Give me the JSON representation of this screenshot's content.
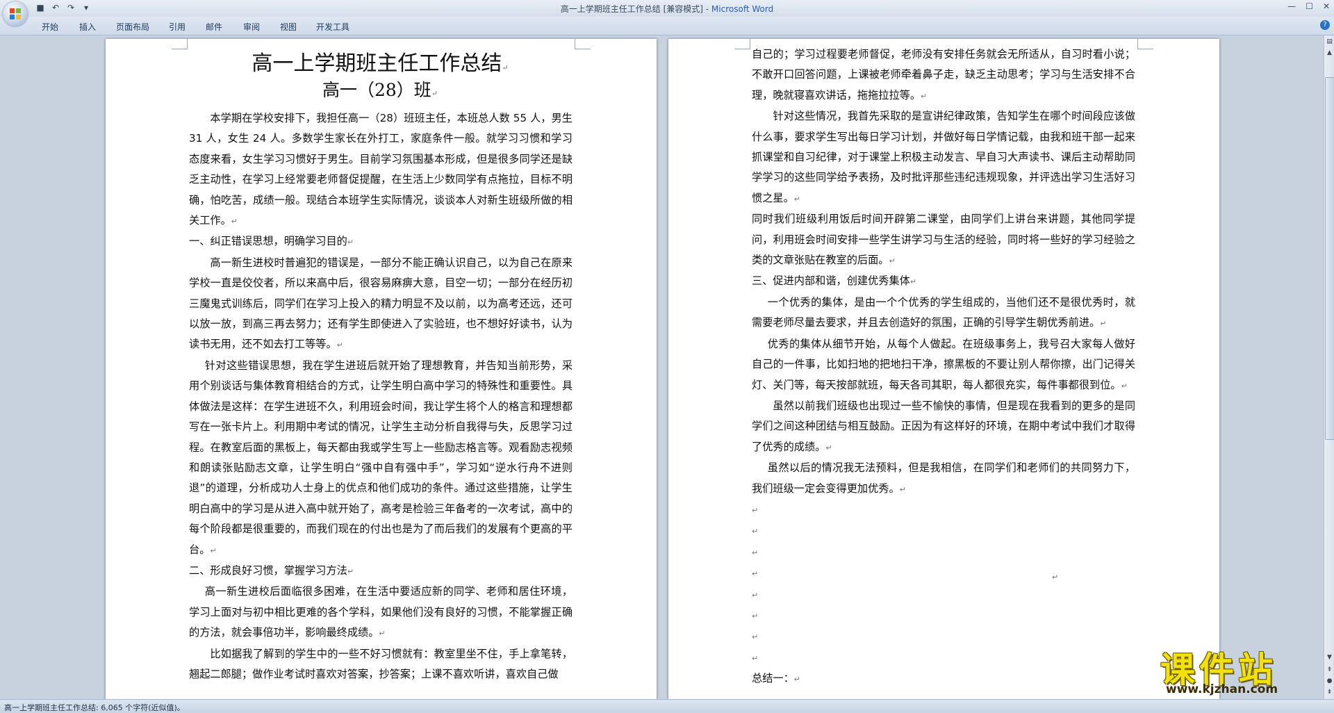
{
  "window": {
    "title": "高一上学期班主任工作总结 [兼容模式] - ",
    "app_name": "Microsoft Word"
  },
  "ribbon": {
    "tabs": [
      "开始",
      "插入",
      "页面布局",
      "引用",
      "邮件",
      "审阅",
      "视图",
      "开发工具"
    ]
  },
  "doc": {
    "title": "高一上学期班主任工作总结",
    "subtitle": "高一（28）班",
    "left_page": [
      {
        "text": "本学期在学校安排下，我担任高一（28）班班主任，本班总人数 55 人，男生 31 人，女生 24 人。多数学生家长在外打工，家庭条件一般。就学习习惯和学习态度来看，女生学习习惯好于男生。目前学习氛围基本形成，但是很多同学还是缺乏主动性，在学习上经常要老师督促提醒，在生活上少数同学有点拖拉，目标不明确，怕吃苦，成绩一般。现结合本班学生实际情况，谈谈本人对新生班级所做的相关工作。",
        "style": "indent"
      },
      {
        "text": "一、纠正错误思想，明确学习目的",
        "style": "plain"
      },
      {
        "text": "高一新生进校时普遍犯的错误是，一部分不能正确认识自己，以为自己在原来学校一直是佼佼者，所以来高中后，很容易麻痹大意，目空一切；一部分在经历初三魔鬼式训练后，同学们在学习上投入的精力明显不及以前，以为高考还远，还可以放一放，到高三再去努力；还有学生即使进入了实验班，也不想好好读书，认为读书无用，还不如去打工等等。",
        "style": "indent"
      },
      {
        "text": "针对这些错误思想，我在学生进班后就开始了理想教育，并告知当前形势，采用个别谈话与集体教育相结合的方式，让学生明白高中学习的特殊性和重要性。具体做法是这样：在学生进班不久，利用班会时间，我让学生将个人的格言和理想都写在一张卡片上。利用期中考试的情况，让学生主动分析自我得与失，反思学习过程。在教室后面的黑板上，每天都由我或学生写上一些励志格言等。观看励志视频和朗读张贴励志文章，让学生明白“强中自有强中手”，学习如“逆水行舟不进则退”的道理，分析成功人士身上的优点和他们成功的条件。通过这些措施，让学生明白高中的学习是从进入高中就开始了，高考是检验三年备考的一次考试，高中的每个阶段都是很重要的，而我们现在的付出也是为了而后我们的发展有个更高的平台。",
        "style": "indent1"
      },
      {
        "text": "二、形成良好习惯，掌握学习方法",
        "style": "plain"
      },
      {
        "text": "高一新生进校后面临很多困难，在生活中要适应新的同学、老师和居住环境，学习上面对与初中相比更难的各个学科，如果他们没有良好的习惯，不能掌握正确的方法，就会事倍功半，影响最终成绩。",
        "style": "indent1"
      },
      {
        "text": "比如据我了解到的学生中的一些不好习惯就有：教室里坐不住，手上拿笔转，翘起二郎腿；做作业考试时喜欢对答案，抄答案；上课不喜欢听讲，喜欢自己做",
        "style": "indent",
        "no_mark": true
      }
    ],
    "right_page": [
      {
        "text": "自己的；学习过程要老师督促，老师没有安排任务就会无所适从，自习时看小说；不敢开口回答问题，上课被老师牵着鼻子走，缺乏主动思考；学习与生活安排不合理，晚就寝喜欢讲话，拖拖拉拉等。",
        "style": "plain"
      },
      {
        "text": "针对这些情况，我首先采取的是宣讲纪律政策，告知学生在哪个时间段应该做什么事，要求学生写出每日学习计划，并做好每日学情记载，由我和班干部一起来抓课堂和自习纪律，对于课堂上积极主动发言、早自习大声读书、课后主动帮助同学学习的这些同学给予表扬，及时批评那些违纪违规现象，并评选出学习生活好习惯之星。",
        "style": "indent"
      },
      {
        "text": "同时我们班级利用饭后时间开辟第二课堂，由同学们上讲台来讲题，其他同学提问，利用班会时间安排一些学生讲学习与生活的经验，同时将一些好的学习经验之类的文章张贴在教室的后面。",
        "style": "plain"
      },
      {
        "text": "三、促进内部和谐，创建优秀集体",
        "style": "plain"
      },
      {
        "text": "一个优秀的集体，是由一个个优秀的学生组成的，当他们还不是很优秀时，就需要老师尽量去要求，并且去创造好的氛围，正确的引导学生朝优秀前进。",
        "style": "indent1"
      },
      {
        "text": "优秀的集体从细节开始，从每个人做起。在班级事务上，我号召大家每人做好自己的一件事，比如扫地的把地扫干净，擦黑板的不要让别人帮你擦，出门记得关灯、关门等，每天按部就班，每天各司其职，每人都很充实，每件事都很到位。",
        "style": "indent1"
      },
      {
        "text": "虽然以前我们班级也出现过一些不愉快的事情，但是现在我看到的更多的是同学们之间这种团结与相互鼓励。正因为有这样好的环境，在期中考试中我们才取得了优秀的成绩。",
        "style": "indent"
      },
      {
        "text": "虽然以后的情况我无法预料，但是我相信，在同学们和老师们的共同努力下，我们班级一定会变得更加优秀。",
        "style": "indent1"
      },
      {
        "text": "",
        "style": "plain"
      },
      {
        "text": "",
        "style": "plain"
      },
      {
        "text": "",
        "style": "plain"
      },
      {
        "text": "",
        "style": "plain"
      },
      {
        "text": "",
        "style": "plain"
      },
      {
        "text": "",
        "style": "plain"
      },
      {
        "text": "",
        "style": "plain"
      },
      {
        "text": "",
        "style": "plain"
      },
      {
        "text": "总结一：",
        "style": "plain"
      }
    ],
    "paragraph_mark": "↵"
  },
  "status": {
    "text": "高一上学期班主任工作总结: 6,065 个字符(近似值)。"
  },
  "watermark": {
    "main": "课件站",
    "url": "www.kjzhan.com"
  },
  "colors": {
    "accent": "#2a5db0",
    "workspace": "#c8d2df",
    "watermark": "#f2e10a"
  }
}
